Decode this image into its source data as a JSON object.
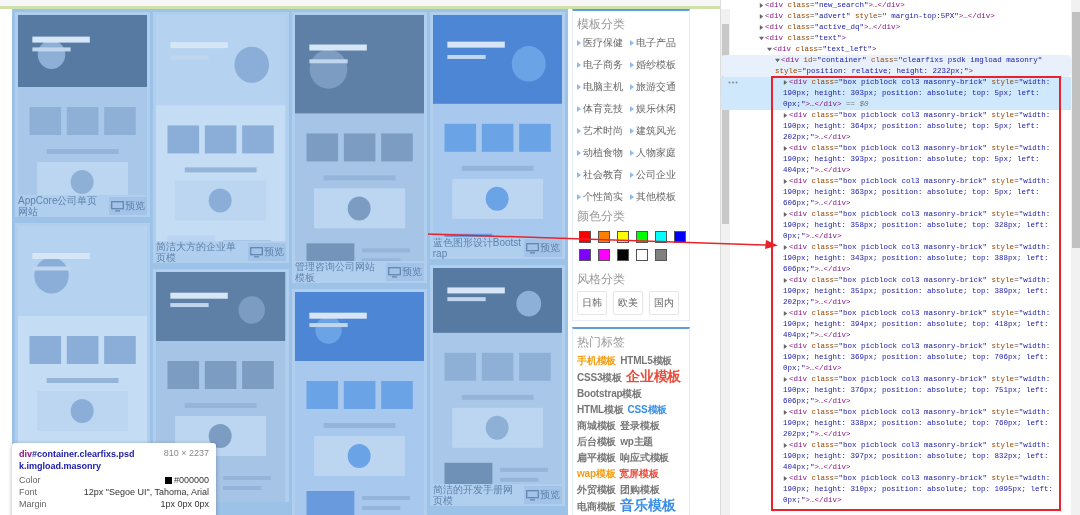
{
  "page": {
    "columns": [
      {
        "cards": [
          {
            "kind": "picture",
            "caption": "AppCore公司单页网站",
            "preview_label": "预览"
          },
          {
            "kind": "picture"
          }
        ]
      },
      {
        "cards": [
          {
            "kind": "picture",
            "caption": "简洁大方的企业单页模",
            "preview_label": "预览"
          },
          {
            "kind": "picture"
          }
        ]
      },
      {
        "cards": [
          {
            "kind": "picture",
            "caption": "管理咨询公司网站模板",
            "preview_label": "预览"
          },
          {
            "kind": "picture"
          }
        ]
      },
      {
        "cards": [
          {
            "kind": "picture",
            "caption": "蓝色图形设计Bootstrap",
            "preview_label": "预览"
          },
          {
            "kind": "picture",
            "caption": "简洁的开发手册网页模",
            "preview_label": "预览"
          }
        ]
      }
    ],
    "sidebar": {
      "title": "模板分类",
      "categories": [
        "医疗保健",
        "电子产品",
        "电子商务",
        "婚纱模板",
        "电脑主机",
        "旅游交通",
        "体育竞技",
        "娱乐休闲",
        "艺术时尚",
        "建筑风光",
        "动植食物",
        "人物家庭",
        "社会教育",
        "公司企业",
        "个性简实",
        "其他模板"
      ],
      "color_title": "颜色分类",
      "colors": [
        {
          "color": "#ff0000"
        },
        {
          "color": "#ff8000"
        },
        {
          "color": "#ffff00"
        },
        {
          "color": "#00ff00"
        },
        {
          "color": "#00ffff"
        },
        {
          "color": "#0000ff"
        },
        {
          "color": "#8000ff"
        },
        {
          "color": "#ff00ff"
        },
        {
          "color": "#000000"
        },
        {
          "color": "#ffffff"
        },
        {
          "color": "#808080"
        }
      ],
      "style_title": "风格分类",
      "styles": [
        "日韩",
        "欧美",
        "国内"
      ]
    },
    "hot_tags": {
      "title": "热门标签",
      "tags": [
        {
          "label": "手机模板",
          "color": "#f39c12",
          "large": false
        },
        {
          "label": "HTML5模板",
          "color": "#777777",
          "large": false
        },
        {
          "label": "CSS3模板",
          "color": "#777777",
          "large": false
        },
        {
          "label": "企业模板",
          "color": "#e74c3c",
          "large": true
        },
        {
          "label": "Bootstrap模板",
          "color": "#777777",
          "large": false
        },
        {
          "label": "HTML模板",
          "color": "#777777",
          "large": false
        },
        {
          "label": "CSS模板",
          "color": "#3a8ee6",
          "large": false
        },
        {
          "label": "商城模板",
          "color": "#777777",
          "large": false
        },
        {
          "label": "登录模板",
          "color": "#777777",
          "large": false
        },
        {
          "label": "后台模板",
          "color": "#777777",
          "large": false
        },
        {
          "label": "wp主题",
          "color": "#777777",
          "large": false
        },
        {
          "label": "扁平模板",
          "color": "#777777",
          "large": false
        },
        {
          "label": "响应式模板",
          "color": "#777777",
          "large": false
        },
        {
          "label": "wap模板",
          "color": "#f39c12",
          "large": false
        },
        {
          "label": "宽屏模板",
          "color": "#e74c3c",
          "large": false
        },
        {
          "label": "外贸模板",
          "color": "#777777",
          "large": false
        },
        {
          "label": "团购模板",
          "color": "#777777",
          "large": false
        },
        {
          "label": "电商模板",
          "color": "#777777",
          "large": false
        },
        {
          "label": "音乐模板",
          "color": "#3a8ee6",
          "large": true
        }
      ]
    }
  },
  "inspector_tooltip": {
    "selector_tag": "div",
    "selector_rest": "#container.clearfixs.psdk.imgload.masonry",
    "dimensions": "810 × 2237",
    "rows": [
      {
        "label": "Color",
        "value": "#000000",
        "color": "#000000"
      },
      {
        "label": "Font",
        "value": "12px \"Segoe UI\", Tahoma, Arial"
      },
      {
        "label": "Margin",
        "value": "1px 0px 0px"
      }
    ]
  },
  "devtools": {
    "nodes": [
      {
        "markup": "<div class=\"new_search\">…</div>",
        "expanded": false,
        "selected": false,
        "hovered": false
      },
      {
        "markup": "<div class=\"advert\" style=\" margin-top:5PX\">…</div>",
        "expanded": false,
        "selected": false,
        "hovered": false
      },
      {
        "markup": "<div class=\"active_dq\">…</div>",
        "expanded": false,
        "selected": false,
        "hovered": false
      },
      {
        "markup": "<div class=\"text\">",
        "expanded": true,
        "selected": false,
        "hovered": false,
        "children": [
          {
            "markup": "<div class=\"text_left\">",
            "expanded": true,
            "selected": false,
            "hovered": false,
            "children": [
              {
                "markup": "<div id=\"container\" class=\"clearfixs psdk imgload masonry\" style=\"position: relative; height: 2232px;\">",
                "expanded": true,
                "selected": false,
                "hovered": true,
                "children": [
                  {
                    "markup": "<div class=\"box picblock col3 masonry-brick\" style=\"width: 190px; height: 303px; position: absolute; top: 5px; left: 0px;\">…</div>",
                    "console_ref": "== $0",
                    "expanded": false,
                    "selected": true,
                    "hovered": false
                  },
                  {
                    "markup": "<div class=\"box picblock col3 masonry-brick\" style=\"width: 190px; height: 364px; position: absolute; top: 5px; left: 202px;\">…</div>",
                    "expanded": false,
                    "selected": false,
                    "hovered": false
                  },
                  {
                    "markup": "<div class=\"box picblock col3 masonry-brick\" style=\"width: 190px; height: 393px; position: absolute; top: 5px; left: 404px;\">…</div>",
                    "expanded": false,
                    "selected": false,
                    "hovered": false
                  },
                  {
                    "markup": "<div class=\"box picblock col3 masonry-brick\" style=\"width: 190px; height: 363px; position: absolute; top: 5px; left: 606px;\">…</div>",
                    "expanded": false,
                    "selected": false,
                    "hovered": false
                  },
                  {
                    "markup": "<div class=\"box picblock col3 masonry-brick\" style=\"width: 190px; height: 358px; position: absolute; top: 328px; left: 0px;\">…</div>",
                    "expanded": false,
                    "selected": false,
                    "hovered": false
                  },
                  {
                    "markup": "<div class=\"box picblock col3 masonry-brick\" style=\"width: 190px; height: 343px; position: absolute; top: 388px; left: 606px;\">…</div>",
                    "expanded": false,
                    "selected": false,
                    "hovered": false
                  },
                  {
                    "markup": "<div class=\"box picblock col3 masonry-brick\" style=\"width: 190px; height: 351px; position: absolute; top: 389px; left: 202px;\">…</div>",
                    "expanded": false,
                    "selected": false,
                    "hovered": false
                  },
                  {
                    "markup": "<div class=\"box picblock col3 masonry-brick\" style=\"width: 190px; height: 394px; position: absolute; top: 418px; left: 404px;\">…</div>",
                    "expanded": false,
                    "selected": false,
                    "hovered": false
                  },
                  {
                    "markup": "<div class=\"box picblock col3 masonry-brick\" style=\"width: 190px; height: 369px; position: absolute; top: 706px; left: 0px;\">…</div>",
                    "expanded": false,
                    "selected": false,
                    "hovered": false
                  },
                  {
                    "markup": "<div class=\"box picblock col3 masonry-brick\" style=\"width: 190px; height: 376px; position: absolute; top: 751px; left: 606px;\">…</div>",
                    "expanded": false,
                    "selected": false,
                    "hovered": false
                  },
                  {
                    "markup": "<div class=\"box picblock col3 masonry-brick\" style=\"width: 190px; height: 338px; position: absolute; top: 760px; left: 202px;\">…</div>",
                    "expanded": false,
                    "selected": false,
                    "hovered": false
                  },
                  {
                    "markup": "<div class=\"box picblock col3 masonry-brick\" style=\"width: 190px; height: 397px; position: absolute; top: 832px; left: 404px;\">…</div>",
                    "expanded": false,
                    "selected": false,
                    "hovered": false
                  },
                  {
                    "markup": "<div class=\"box picblock col3 masonry-brick\" style=\"width: 190px; height: 310px; position: absolute; top: 1095px; left: 0px;\">…</div>",
                    "expanded": false,
                    "selected": false,
                    "hovered": false
                  }
                ]
              }
            ]
          }
        ]
      }
    ]
  }
}
